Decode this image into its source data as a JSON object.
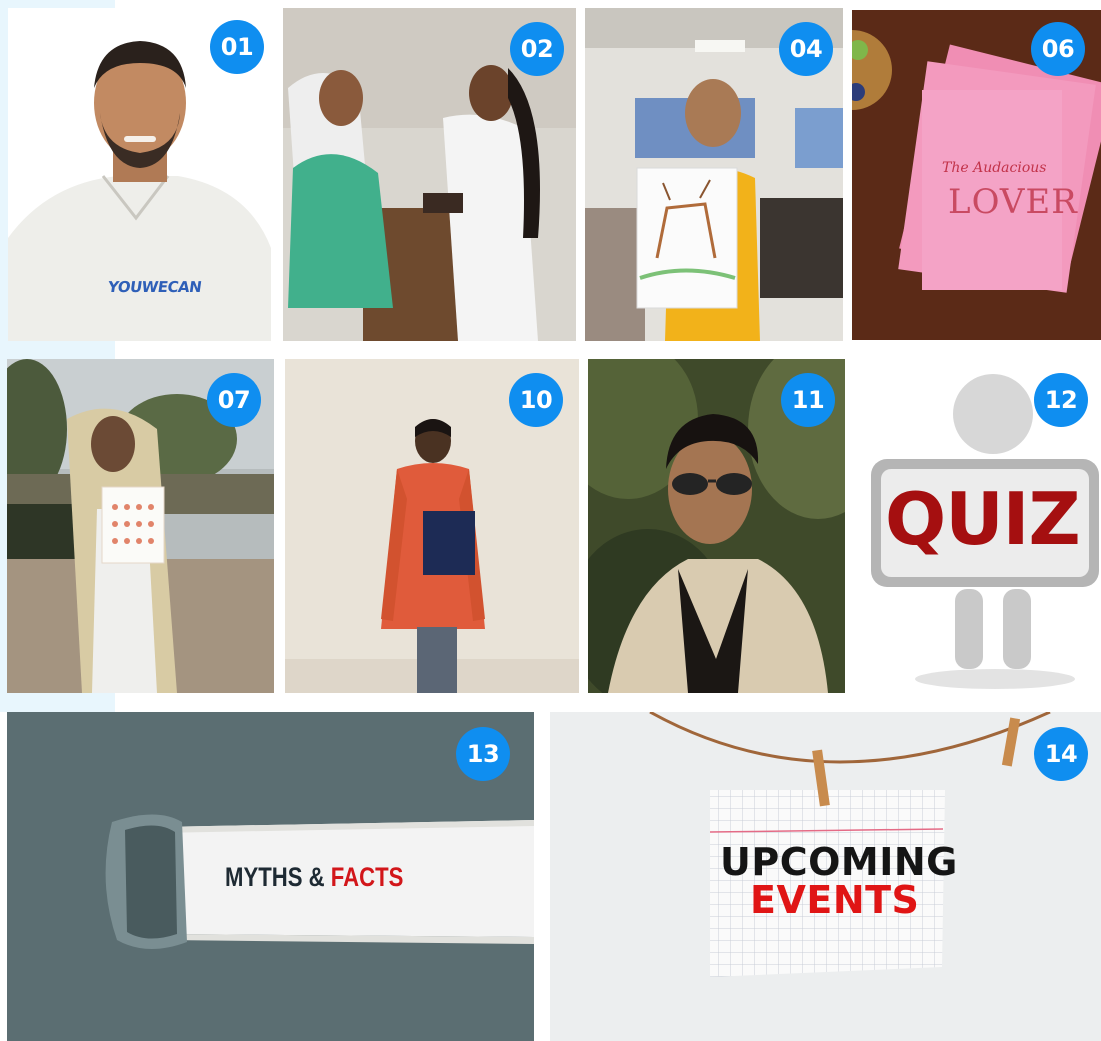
{
  "gallery": {
    "tiles": [
      {
        "badge": "01",
        "logo_text": "YOUWECAN"
      },
      {
        "badge": "02"
      },
      {
        "badge": "04"
      },
      {
        "badge": "06",
        "book_title": "The Audacious",
        "book_word": "LOVER"
      },
      {
        "badge": "07"
      },
      {
        "badge": "10"
      },
      {
        "badge": "11"
      },
      {
        "badge": "12",
        "sign_text": "QUIZ"
      },
      {
        "badge": "13",
        "myths": "MYTHS",
        "amp": "&",
        "facts": "FACTS"
      },
      {
        "badge": "14",
        "line1": "UPCOMING",
        "line2": "EVENTS"
      }
    ]
  },
  "colors": {
    "badge": "#0f8ef0",
    "page_bg": "#ffffff",
    "strip": "#e8f6fd"
  }
}
